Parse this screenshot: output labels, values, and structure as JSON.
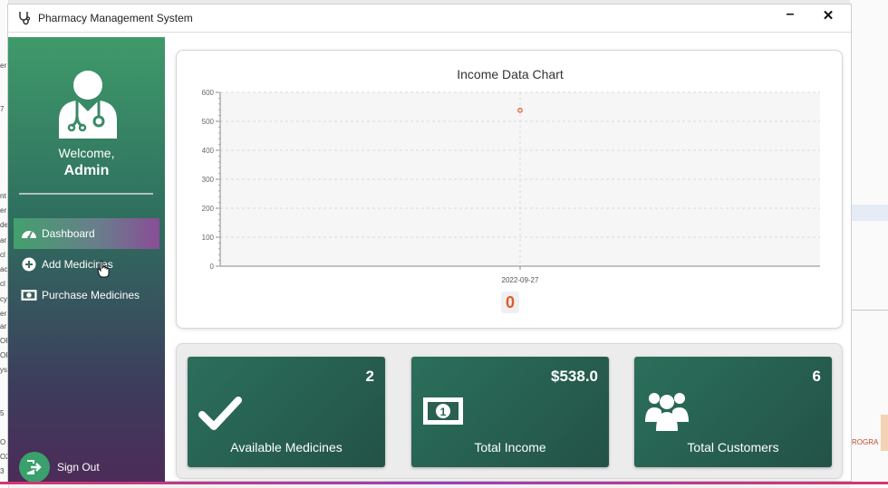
{
  "window": {
    "title": "Pharmacy Management System",
    "minimize_glyph": "–",
    "close_glyph": "✕"
  },
  "sidebar": {
    "welcome": "Welcome,",
    "username": "Admin",
    "items": [
      {
        "label": "Dashboard",
        "icon": "dashboard-icon",
        "active": true
      },
      {
        "label": "Add Medicines",
        "icon": "plus-circle-icon",
        "active": false
      },
      {
        "label": "Purchase Medicines",
        "icon": "money-icon",
        "active": false
      }
    ],
    "signout_label": "Sign Out"
  },
  "chart": {
    "zero_label": "0"
  },
  "chart_data": {
    "type": "line",
    "title": "Income Data Chart",
    "x": [
      "2022-09-27"
    ],
    "series": [
      {
        "values": [
          538
        ]
      }
    ],
    "ylim": [
      0,
      600
    ],
    "yticks": [
      0,
      100,
      200,
      300,
      400,
      500,
      600
    ],
    "grid": true,
    "point_color": "#e05a2b"
  },
  "stats": [
    {
      "value": "2",
      "label": "Available Medicines",
      "icon": "check-icon"
    },
    {
      "value": "$538.0",
      "label": "Total Income",
      "icon": "money-icon"
    },
    {
      "value": "6",
      "label": "Total Customers",
      "icon": "users-icon"
    }
  ],
  "background": {
    "left_fragments": [
      "er",
      "7",
      "nt",
      "er",
      "de",
      "ar",
      "cl",
      "ac",
      "cl",
      "cy",
      "er",
      "ar",
      "OF",
      "OF",
      "ys",
      "5",
      "O",
      "O2",
      "3"
    ],
    "right_fragment": "ROGRA"
  },
  "colors": {
    "sidebar_top": "#3f9a6a",
    "sidebar_bottom": "#4d2b59",
    "card_green": "#2b6f5b",
    "accent_orange": "#e05a2b"
  }
}
